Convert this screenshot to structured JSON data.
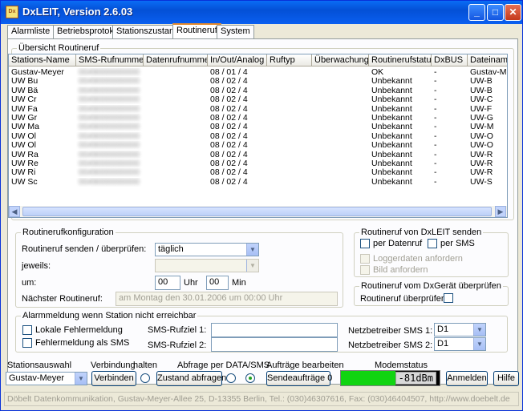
{
  "window": {
    "title": "DxLEIT, Version 2.6.03",
    "app_icon": "DxLEIT"
  },
  "tabs": [
    {
      "label": "Alarmliste"
    },
    {
      "label": "Betriebsprotokoll"
    },
    {
      "label": "Stationszustand"
    },
    {
      "label": "Routineruf"
    },
    {
      "label": "System"
    }
  ],
  "overview": {
    "legend": "Übersicht Routineruf",
    "columns": [
      "Stations-Name",
      "SMS-Rufnummer",
      "Datenrufnummer",
      "In/Out/Analog",
      "Ruftyp",
      "Überwachung",
      "Routinerufstatus",
      "DxBUS",
      "Dateiname"
    ],
    "rows": [
      [
        "Gustav-Meyer",
        "0049000000000",
        "",
        "08 / 01 / 4",
        "",
        "",
        "OK",
        "-",
        "Gustav-Mey"
      ],
      [
        "UW Bu",
        "0049000000000",
        "",
        "08 / 02 / 4",
        "",
        "",
        "Unbekannt",
        "-",
        "UW-B"
      ],
      [
        "UW Bä",
        "0049000000000",
        "",
        "08 / 02 / 4",
        "",
        "",
        "Unbekannt",
        "-",
        "UW-B"
      ],
      [
        "UW Cr",
        "0049000000000",
        "",
        "08 / 02 / 4",
        "",
        "",
        "Unbekannt",
        "-",
        "UW-C"
      ],
      [
        "UW Fa",
        "0049000000000",
        "",
        "08 / 02 / 4",
        "",
        "",
        "Unbekannt",
        "-",
        "UW-F"
      ],
      [
        "UW Gr",
        "0049000000000",
        "",
        "08 / 02 / 4",
        "",
        "",
        "Unbekannt",
        "-",
        "UW-G"
      ],
      [
        "UW Ma",
        "0049000000000",
        "",
        "08 / 02 / 4",
        "",
        "",
        "Unbekannt",
        "-",
        "UW-M"
      ],
      [
        "UW Ol",
        "0049000000000",
        "",
        "08 / 02 / 4",
        "",
        "",
        "Unbekannt",
        "-",
        "UW-O"
      ],
      [
        "UW Ol",
        "0049000000000",
        "",
        "08 / 02 / 4",
        "",
        "",
        "Unbekannt",
        "-",
        "UW-O"
      ],
      [
        "UW Ra",
        "0049000000000",
        "",
        "08 / 02 / 4",
        "",
        "",
        "Unbekannt",
        "-",
        "UW-R"
      ],
      [
        "UW Re",
        "0049000000000",
        "",
        "08 / 02 / 4",
        "",
        "",
        "Unbekannt",
        "-",
        "UW-R"
      ],
      [
        "UW Ri",
        "0049000000000",
        "",
        "08 / 02 / 4",
        "",
        "",
        "Unbekannt",
        "-",
        "UW-R"
      ],
      [
        "UW Sc",
        "0049000000000",
        "",
        "08 / 02 / 4",
        "",
        "",
        "Unbekannt",
        "-",
        "UW-S"
      ]
    ]
  },
  "config": {
    "legend": "Routinerufkonfiguration",
    "send_label": "Routineruf senden / überprüfen:",
    "send_value": "täglich",
    "each_label": "jeweils:",
    "each_value": "",
    "at_label": "um:",
    "hour_value": "00",
    "hour_unit": "Uhr",
    "minute_value": "00",
    "minute_unit": "Min",
    "next_label": "Nächster Routineruf:",
    "next_value": "am Montag den 30.01.2006 um 00:00 Uhr"
  },
  "send_from": {
    "legend": "Routineruf von DxLEIT senden",
    "per_datenruf": "per Datenruf",
    "per_sms": "per SMS",
    "loggerdaten": "Loggerdaten anfordern",
    "bild": "Bild anfordern"
  },
  "check": {
    "legend": "Routineruf vom DxGerät überprüfen",
    "label": "Routineruf überprüfen:"
  },
  "alarm": {
    "legend": "Alarmmeldung wenn Station nicht erreichbar",
    "local": "Lokale Fehlermeldung",
    "sms": "Fehlermeldung als SMS",
    "target1_label": "SMS-Rufziel 1:",
    "target2_label": "SMS-Rufziel 2:",
    "target1": "",
    "target2": "",
    "op1_label": "Netzbetreiber SMS 1:",
    "op2_label": "Netzbetreiber SMS 2:",
    "op1": "D1",
    "op2": "D1"
  },
  "bottom": {
    "station_label": "Stationsauswahl",
    "station_value": "Gustav-Meyer",
    "connection_label": "Verbindung",
    "hold_label": "halten",
    "connect_button": "Verbinden",
    "query_label": "Abfrage per DATA/SMS",
    "status_button": "Zustand abfragen",
    "jobs_label": "Aufträge bearbeiten",
    "send_jobs_button": "Sendeaufträge 0",
    "modem_label": "Modemstatus",
    "modem_value": "-81dBm",
    "modem_level": 0.55,
    "login_button": "Anmelden",
    "help_button": "Hilfe"
  },
  "statusbar": "Döbelt Datenkommunikation, Gustav-Meyer-Allee 25, D-13355 Berlin, Tel.: (030)46307616, Fax: (030)46404507, http://www.doebelt.de"
}
